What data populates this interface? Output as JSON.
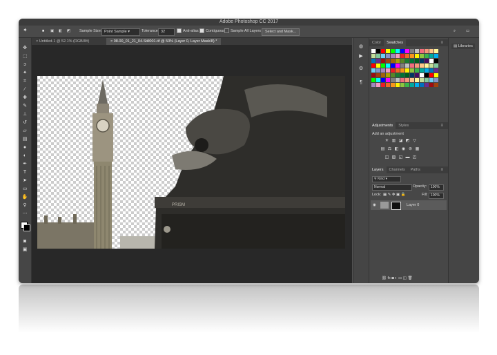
{
  "window": {
    "title": "Adobe Photoshop CC 2017"
  },
  "options_bar": {
    "sample_size_label": "Sample Size:",
    "sample_size_value": "Point Sample",
    "tolerance_label": "Tolerance:",
    "tolerance_value": "32",
    "antialias_label": "Anti-alias",
    "contiguous_label": "Contiguous",
    "sample_all_label": "Sample All Layers",
    "select_mask_label": "Select and Mask..."
  },
  "tabs": [
    {
      "label": "Untitled-1 @ 52.1% (RGB/8#)"
    },
    {
      "label": "08.00_01_21_04.Still001.tif @ 50% (Layer 0, Layer Mask/8) *"
    }
  ],
  "panels": {
    "color_tab": "Color",
    "swatches_tab": "Swatches",
    "adjustments_tab": "Adjustments",
    "styles_tab": "Styles",
    "add_adjustment": "Add an adjustment",
    "layers_tab": "Layers",
    "channels_tab": "Channels",
    "paths_tab": "Paths",
    "kind_label": "Kind",
    "blend_mode": "Normal",
    "opacity_label": "Opacity:",
    "opacity_value": "100%",
    "lock_label": "Lock:",
    "fill_label": "Fill:",
    "fill_value": "100%",
    "layer_name": "Layer 0"
  },
  "libraries": {
    "label": "Libraries"
  },
  "swatch_colors": [
    "#ffffff",
    "#000000",
    "#ff0000",
    "#ffff00",
    "#00ff00",
    "#00ffff",
    "#0000ff",
    "#ff00ff",
    "#7f7f7f",
    "#c0c0c0",
    "#f26d7d",
    "#f7977a",
    "#fdc68a",
    "#fff79a",
    "#c4df9b",
    "#82ca9d",
    "#6dcff6",
    "#8493ca",
    "#a187be",
    "#f49ac2",
    "#ed1c24",
    "#f26522",
    "#f7941d",
    "#fff200",
    "#8dc63f",
    "#39b54a",
    "#00a99d",
    "#00aeef",
    "#0072bc",
    "#662d91",
    "#9e0b0f",
    "#a0410d",
    "#a36209",
    "#aba000",
    "#598527",
    "#197b30",
    "#007236",
    "#005e20",
    "#003663",
    "#440e62"
  ]
}
